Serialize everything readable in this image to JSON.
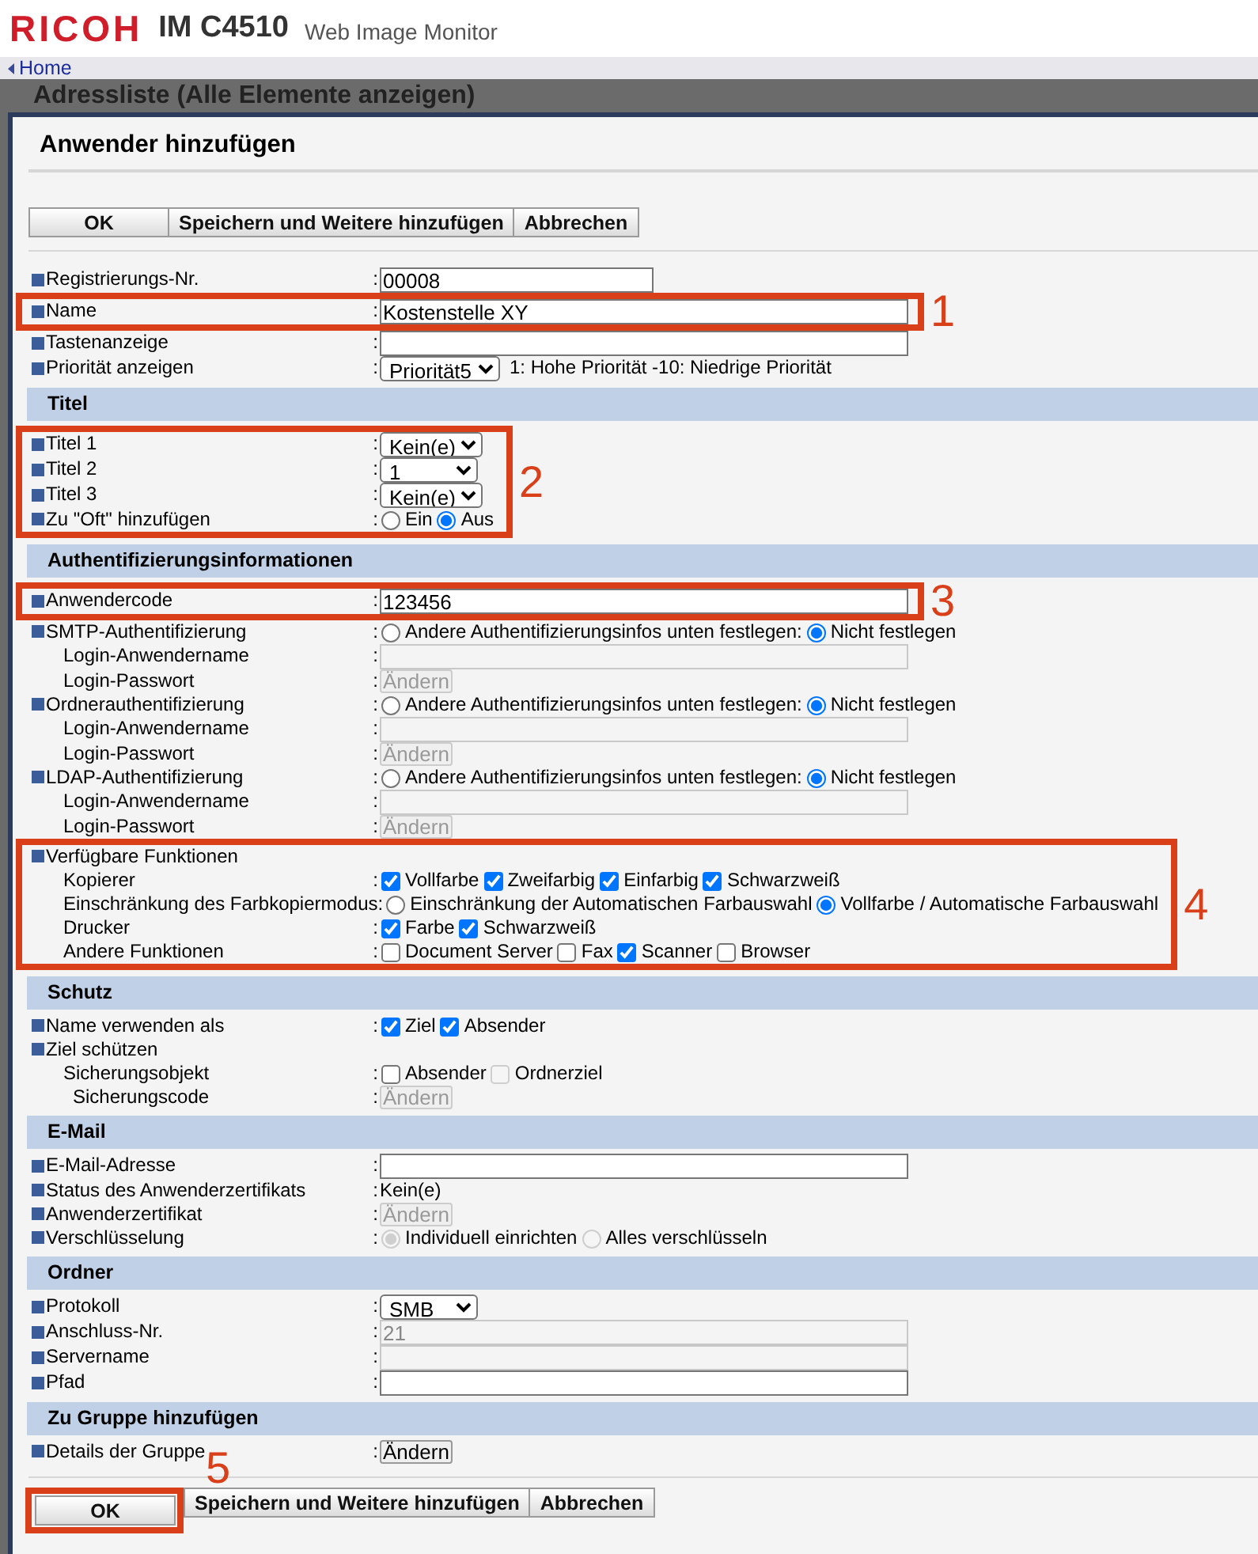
{
  "header": {
    "brand": "RICOH",
    "model": "IM C4510",
    "product": "Web Image Monitor"
  },
  "breadcrumb": {
    "link": "Home"
  },
  "background_title": "Adressliste (Alle Elemente anzeigen)",
  "dialog": {
    "title": "Anwender hinzufügen",
    "top_buttons": [
      {
        "label": "OK"
      },
      {
        "label": "Speichern und Weitere hinzufügen"
      },
      {
        "label": "Abbrechen"
      }
    ],
    "sections": [
      {
        "rows": [
          {
            "label": "Registrierungs-Nr.",
            "colon": ":",
            "control": {
              "kind": "short-text",
              "value": "00008",
              "disabled": false
            }
          },
          {
            "callout": "1",
            "rows": [
              {
                "label": "Name",
                "colon": ":",
                "control": {
                  "kind": "text",
                  "value": "Kostenstelle XY",
                  "disabled": false
                }
              }
            ]
          },
          {
            "label": "Tastenanzeige",
            "colon": ":",
            "control": {
              "kind": "text",
              "disabled": false
            }
          },
          {
            "label": "Priorität anzeigen",
            "colon": ":",
            "control": {
              "kind": "select",
              "value": "Priorität5",
              "note": "1: Hohe Priorität -10: Niedrige Priorität"
            }
          }
        ]
      },
      {
        "title": "Titel",
        "rows": [
          {
            "callout": "2",
            "rows": [
              {
                "label": "Titel 1",
                "colon": ":",
                "control": {
                  "kind": "select",
                  "value": "Kein(e)"
                }
              },
              {
                "label": "Titel 2",
                "colon": ":",
                "control": {
                  "kind": "select",
                  "value": "1"
                }
              },
              {
                "label": "Titel 3",
                "colon": ":",
                "control": {
                  "kind": "select",
                  "value": "Kein(e)"
                }
              },
              {
                "label": "Zu \"Oft\" hinzufügen",
                "colon": ":",
                "control": {
                  "kind": "radio",
                  "disabled": false,
                  "options": [
                    {
                      "label": "Ein",
                      "selected": false
                    },
                    {
                      "label": "Aus",
                      "selected": true
                    }
                  ]
                }
              }
            ]
          }
        ]
      },
      {
        "title": "Authentifizierungsinformationen",
        "rows": [
          {
            "callout": "3",
            "rows": [
              {
                "label": "Anwendercode",
                "colon": ":",
                "control": {
                  "kind": "text",
                  "value": "123456",
                  "disabled": false
                }
              }
            ]
          },
          {
            "label": "SMTP-Authentifizierung",
            "colon": ":",
            "control": {
              "kind": "radio",
              "disabled": false,
              "options": [
                {
                  "label": "Andere Authentifizierungsinfos unten festlegen:",
                  "selected": false
                },
                {
                  "label": "Nicht festlegen",
                  "selected": true
                }
              ]
            },
            "children": [
              {
                "label": "Login-Anwendername",
                "colon": ":",
                "control": {
                  "kind": "text",
                  "disabled": true
                }
              },
              {
                "label": "Login-Passwort",
                "colon": ":",
                "control": {
                  "kind": "button",
                  "label": "Ändern",
                  "disabled": true
                }
              }
            ]
          },
          {
            "label": "Ordnerauthentifizierung",
            "colon": ":",
            "control": {
              "kind": "radio",
              "disabled": false,
              "options": [
                {
                  "label": "Andere Authentifizierungsinfos unten festlegen:",
                  "selected": false
                },
                {
                  "label": "Nicht festlegen",
                  "selected": true
                }
              ]
            },
            "children": [
              {
                "label": "Login-Anwendername",
                "colon": ":",
                "control": {
                  "kind": "text",
                  "disabled": true
                }
              },
              {
                "label": "Login-Passwort",
                "colon": ":",
                "control": {
                  "kind": "button",
                  "label": "Ändern",
                  "disabled": true
                }
              }
            ]
          },
          {
            "label": "LDAP-Authentifizierung",
            "colon": ":",
            "control": {
              "kind": "radio",
              "disabled": false,
              "options": [
                {
                  "label": "Andere Authentifizierungsinfos unten festlegen:",
                  "selected": false
                },
                {
                  "label": "Nicht festlegen",
                  "selected": true
                }
              ]
            },
            "children": [
              {
                "label": "Login-Anwendername",
                "colon": ":",
                "control": {
                  "kind": "text",
                  "disabled": true
                }
              },
              {
                "label": "Login-Passwort",
                "colon": ":",
                "control": {
                  "kind": "button",
                  "label": "Ändern",
                  "disabled": true
                }
              }
            ]
          },
          {
            "callout": "4",
            "rows": [
              {
                "label": "Verfügbare Funktionen",
                "children": [
                  {
                    "label": "Kopierer",
                    "colon": ":",
                    "control": {
                      "kind": "checkbox",
                      "options": [
                        {
                          "label": "Vollfarbe",
                          "checked": true,
                          "disabled": false
                        },
                        {
                          "label": "Zweifarbig",
                          "checked": true,
                          "disabled": false
                        },
                        {
                          "label": "Einfarbig",
                          "checked": true,
                          "disabled": false
                        },
                        {
                          "label": "Schwarzweiß",
                          "checked": true,
                          "disabled": false
                        }
                      ]
                    }
                  },
                  {
                    "label": "Einschränkung des Farbkopiermodus",
                    "colon": ":",
                    "control": {
                      "kind": "radio",
                      "disabled": false,
                      "options": [
                        {
                          "label": "Einschränkung der Automatischen Farbauswahl",
                          "selected": false
                        },
                        {
                          "label": "Vollfarbe / Automatische Farbauswahl",
                          "selected": true
                        }
                      ]
                    }
                  },
                  {
                    "label": "Drucker",
                    "colon": ":",
                    "control": {
                      "kind": "checkbox",
                      "options": [
                        {
                          "label": "Farbe",
                          "checked": true,
                          "disabled": false
                        },
                        {
                          "label": "Schwarzweiß",
                          "checked": true,
                          "disabled": false
                        }
                      ]
                    }
                  },
                  {
                    "label": "Andere Funktionen",
                    "colon": ":",
                    "control": {
                      "kind": "checkbox",
                      "options": [
                        {
                          "label": "Document Server",
                          "checked": false,
                          "disabled": false
                        },
                        {
                          "label": "Fax",
                          "checked": false,
                          "disabled": false
                        },
                        {
                          "label": "Scanner",
                          "checked": true,
                          "disabled": false
                        },
                        {
                          "label": "Browser",
                          "checked": false,
                          "disabled": false
                        }
                      ]
                    }
                  }
                ]
              }
            ]
          }
        ]
      },
      {
        "title": "Schutz",
        "rows": [
          {
            "label": "Name verwenden als",
            "colon": ":",
            "control": {
              "kind": "checkbox",
              "options": [
                {
                  "label": "Ziel",
                  "checked": true,
                  "disabled": false
                },
                {
                  "label": "Absender",
                  "checked": true,
                  "disabled": false
                }
              ]
            }
          },
          {
            "label": "Ziel schützen",
            "children": [
              {
                "label": "Sicherungsobjekt",
                "colon": ":",
                "control": {
                  "kind": "checkbox",
                  "options": [
                    {
                      "label": "Absender",
                      "checked": false,
                      "disabled": false
                    },
                    {
                      "label": "Ordnerziel",
                      "checked": false,
                      "disabled": true
                    }
                  ]
                },
                "children": [
                  {
                    "label": "Sicherungscode",
                    "colon": ":",
                    "control": {
                      "kind": "button",
                      "label": "Ändern",
                      "disabled": true
                    }
                  }
                ]
              }
            ]
          }
        ]
      },
      {
        "title": "E-Mail",
        "rows": [
          {
            "label": "E-Mail-Adresse",
            "colon": ":",
            "control": {
              "kind": "text",
              "disabled": false
            }
          },
          {
            "label": "Status des Anwenderzertifikats",
            "colon": ":",
            "control": {
              "kind": "static",
              "text": "Kein(e)"
            }
          },
          {
            "label": "Anwenderzertifikat",
            "colon": ":",
            "control": {
              "kind": "button",
              "label": "Ändern",
              "disabled": true
            }
          },
          {
            "label": "Verschlüsselung",
            "colon": ":",
            "control": {
              "kind": "radio",
              "disabled": true,
              "options": [
                {
                  "label": "Individuell einrichten",
                  "selected": true
                },
                {
                  "label": "Alles verschlüsseln",
                  "selected": false
                }
              ]
            }
          }
        ]
      },
      {
        "title": "Ordner",
        "rows": [
          {
            "label": "Protokoll",
            "colon": ":",
            "control": {
              "kind": "select",
              "value": "SMB"
            }
          },
          {
            "label": "Anschluss-Nr.",
            "colon": ":",
            "control": {
              "kind": "text",
              "value": "21",
              "disabled": true
            }
          },
          {
            "label": "Servername",
            "colon": ":",
            "control": {
              "kind": "text",
              "disabled": true
            }
          },
          {
            "label": "Pfad",
            "colon": ":",
            "control": {
              "kind": "text",
              "disabled": false
            }
          }
        ]
      },
      {
        "title": "Zu Gruppe hinzufügen",
        "rows": [
          {
            "label": "Details der Gruppe",
            "colon": ":",
            "control": {
              "kind": "button",
              "label": "Ändern",
              "disabled": false
            }
          }
        ]
      }
    ],
    "bottom_buttons": [
      {
        "label": "OK",
        "callout": "5"
      },
      {
        "label": "Speichern und Weitere hinzufügen"
      },
      {
        "label": "Abbrechen"
      }
    ]
  }
}
